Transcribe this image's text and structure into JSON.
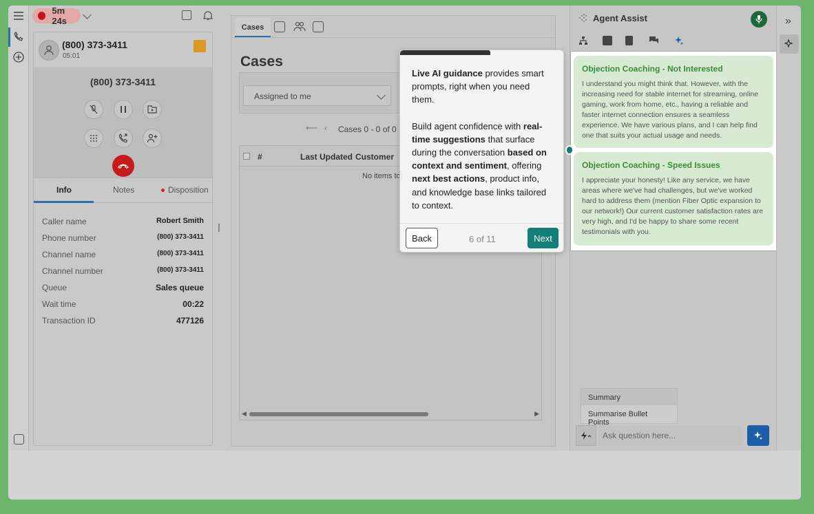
{
  "left_rail": {
    "icons": [
      "menu-icon",
      "phone-icon",
      "add-circle-icon",
      "contacts-icon"
    ]
  },
  "topbar": {
    "recording_time": "5m 24s"
  },
  "call": {
    "header_number": "(800) 373-3411",
    "header_duration": "05:01",
    "center_number": "(800) 373-3411",
    "tabs": [
      "Info",
      "Notes",
      "Disposition"
    ],
    "info": [
      {
        "label": "Caller name",
        "value": "Robert Smith"
      },
      {
        "label": "Phone number",
        "value": "(800) 373-3411"
      },
      {
        "label": "Channel name",
        "value": "(800) 373-3411"
      },
      {
        "label": "Channel number",
        "value": "(800) 373-3411"
      },
      {
        "label": "Queue",
        "value": "Sales queue"
      },
      {
        "label": "Wait time",
        "value": "00:22"
      },
      {
        "label": "Transaction ID",
        "value": "477126"
      }
    ]
  },
  "cases": {
    "tab_label": "Cases",
    "title": "Cases",
    "filter_value": "Assigned to me",
    "pager_text": "Cases 0 - 0 of 0",
    "columns": [
      "#",
      "Last Updated",
      "Customer"
    ],
    "empty_message": "No items to"
  },
  "agent_assist": {
    "title": "Agent Assist",
    "cards": [
      {
        "title": "Objection Coaching - Not Interested",
        "body": "I understand you might think that. However, with the increasing need for stable internet for streaming, online gaming, work from home, etc., having a reliable and faster internet connection ensures a seamless experience. We have various plans, and I can help find one that suits your actual usage and needs."
      },
      {
        "title": "Objection Coaching - Speed Issues",
        "body": "I appreciate your honesty! Like any service, we have areas where we've had challenges, but we've worked hard to address them (mention Fiber Optic expansion to our network!) Our current customer satisfaction rates are very high, and I'd be happy to share some recent testimonials with you."
      }
    ],
    "suggestions": [
      "Summary",
      "Summarise Bullet Points"
    ],
    "ask_placeholder": "Ask question here..."
  },
  "tour": {
    "p1_bold": "Live AI guidance",
    "p1_rest": " provides smart prompts, right when you need them.",
    "p2_a": "Build agent confidence with ",
    "p2_b": "real-time suggestions",
    "p2_c": " that surface during the conversation ",
    "p2_d": "based on context and sentiment",
    "p2_e": ", offering ",
    "p2_f": "next best actions",
    "p2_g": ", product info, and knowledge base links tailored to context.",
    "back_label": "Back",
    "step_text": "6 of 11",
    "next_label": "Next"
  },
  "colors": {
    "accent": "#2a6fb0",
    "teal": "#117e78",
    "record": "#c01818",
    "coaching_green": "#3f8a3f"
  }
}
